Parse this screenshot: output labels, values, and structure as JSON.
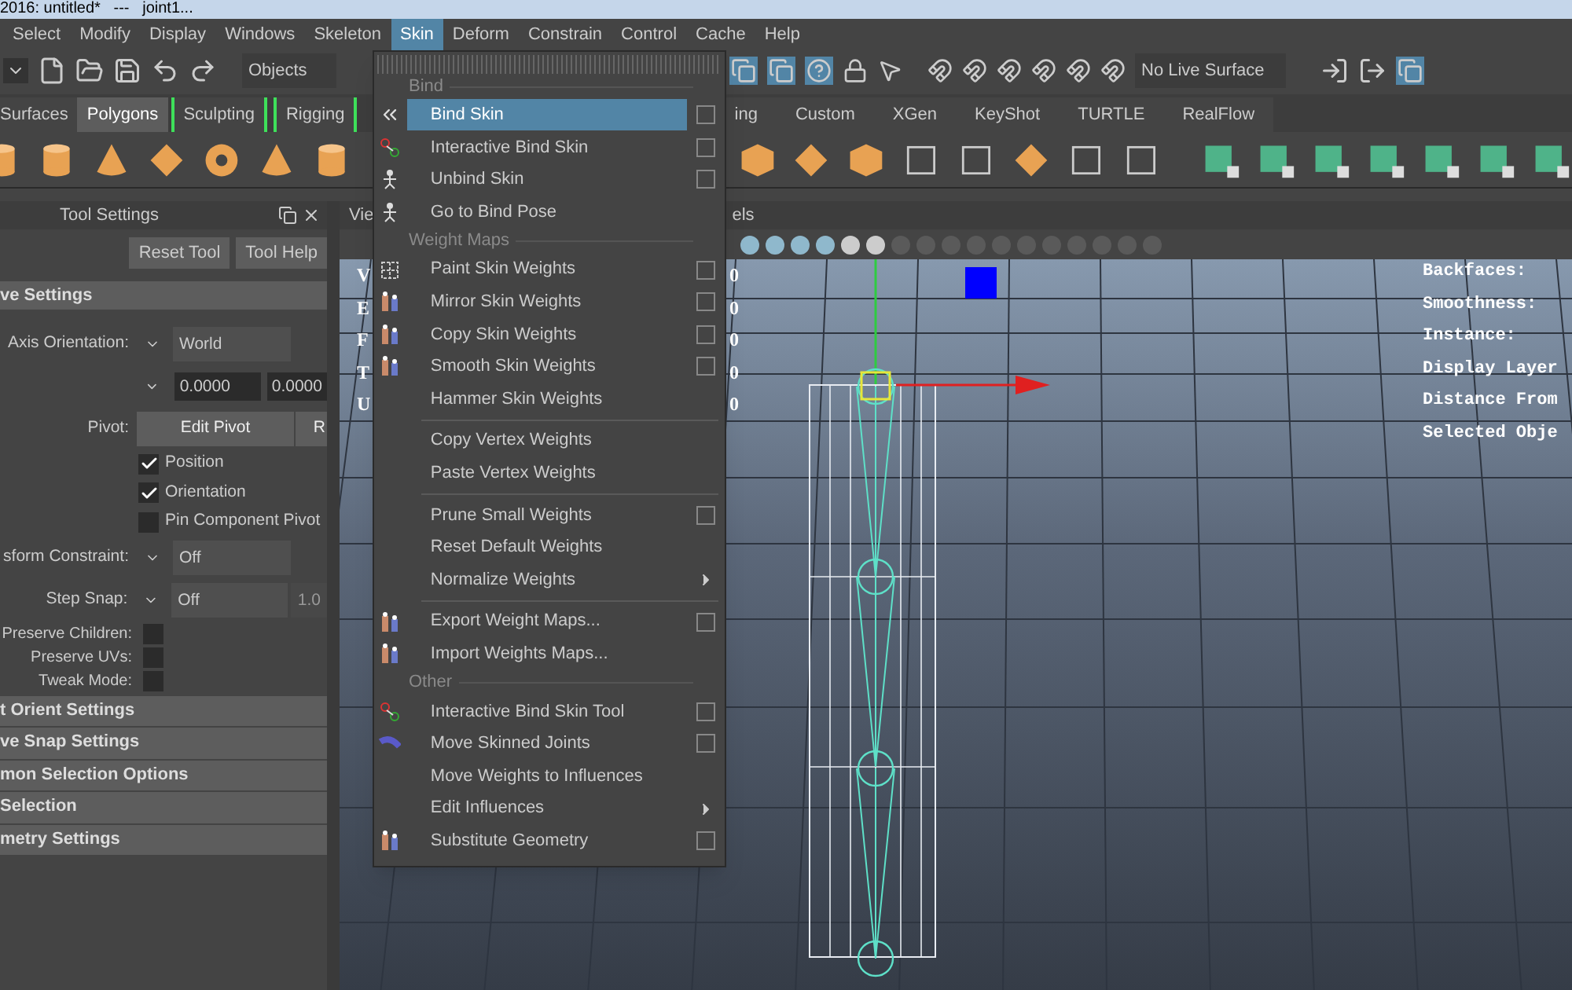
{
  "title_bar": {
    "title": "2016: untitled*   ---   joint1..."
  },
  "menu_bar": [
    {
      "label": "Select",
      "selected": false
    },
    {
      "label": "Modify",
      "selected": false
    },
    {
      "label": "Display",
      "selected": false
    },
    {
      "label": "Windows",
      "selected": false
    },
    {
      "label": "Skeleton",
      "selected": false
    },
    {
      "label": "Skin",
      "selected": true
    },
    {
      "label": "Deform",
      "selected": false
    },
    {
      "label": "Constrain",
      "selected": false
    },
    {
      "label": "Control",
      "selected": false
    },
    {
      "label": "Cache",
      "selected": false
    },
    {
      "label": "Help",
      "selected": false
    }
  ],
  "toolbar": {
    "selection_mode": "Objects",
    "live_surface": "No Live Surface"
  },
  "shelf_tabs": [
    {
      "label": "Surfaces",
      "selected": false,
      "bracketed": false
    },
    {
      "label": "Polygons",
      "selected": true,
      "bracketed": false
    },
    {
      "label": "Sculpting",
      "selected": false,
      "bracketed": true
    },
    {
      "label": "Rigging",
      "selected": false,
      "bracketed": true
    },
    {
      "label": "ing",
      "selected": false,
      "bracketed": false
    },
    {
      "label": "Custom",
      "selected": false,
      "bracketed": false
    },
    {
      "label": "XGen",
      "selected": false,
      "bracketed": false
    },
    {
      "label": "KeyShot",
      "selected": false,
      "bracketed": false
    },
    {
      "label": "TURTLE",
      "selected": false,
      "bracketed": false
    },
    {
      "label": "RealFlow",
      "selected": false,
      "bracketed": false
    }
  ],
  "tool_settings": {
    "title": "Tool Settings",
    "buttons": [
      "Reset Tool",
      "Tool Help"
    ],
    "section": "ve Settings",
    "rows": [
      {
        "kind": "dropdown",
        "label": "Axis Orientation:",
        "value": "World"
      },
      {
        "kind": "numbers",
        "values": [
          "0.0000",
          "0.0000"
        ]
      },
      {
        "kind": "buttons",
        "label": "Pivot:",
        "buttons": [
          "Edit Pivot",
          "R"
        ]
      },
      {
        "kind": "check",
        "label": "Position",
        "checked": true
      },
      {
        "kind": "check",
        "label": "Orientation",
        "checked": true
      },
      {
        "kind": "check",
        "label": "Pin Component Pivot",
        "checked": false
      },
      {
        "kind": "dropdown",
        "label": "sform Constraint:",
        "value": "Off"
      },
      {
        "kind": "dropdown",
        "label": "Step Snap:",
        "value": "Off",
        "extra": "1.0"
      },
      {
        "kind": "labeled_check",
        "label": "Preserve Children:",
        "checked": false
      },
      {
        "kind": "labeled_check",
        "label": "Preserve UVs:",
        "checked": false
      },
      {
        "kind": "labeled_check",
        "label": "Tweak Mode:",
        "checked": false
      }
    ],
    "collapsed_sections": [
      "t Orient Settings",
      "ve Snap Settings",
      "mon Selection Options",
      "Selection",
      "metry Settings"
    ]
  },
  "viewport": {
    "panel_tabs": [
      "Vie",
      "els"
    ],
    "hud_left": [
      {
        "label": "V",
        "value": "0"
      },
      {
        "label": "E",
        "value": "0"
      },
      {
        "label": "F",
        "value": "0"
      },
      {
        "label": "T",
        "value": "0"
      },
      {
        "label": "U",
        "value": "0"
      }
    ],
    "hud_right": [
      "Backfaces:",
      "Smoothness:",
      "Instance:",
      "Display Layer",
      "Distance From",
      "Selected Obje"
    ]
  },
  "skin_menu": {
    "items": [
      {
        "kind": "header",
        "label": "Bind"
      },
      {
        "kind": "option_item",
        "label": "Bind Skin",
        "selected": true
      },
      {
        "kind": "option_item",
        "label": "Interactive Bind Skin",
        "selected": false
      },
      {
        "kind": "option_item",
        "label": "Unbind Skin",
        "selected": false
      },
      {
        "kind": "item",
        "label": "Go to Bind Pose",
        "selected": false
      },
      {
        "kind": "header",
        "label": "Weight Maps"
      },
      {
        "kind": "option_item",
        "label": "Paint Skin Weights",
        "selected": false
      },
      {
        "kind": "option_item",
        "label": "Mirror Skin Weights",
        "selected": false
      },
      {
        "kind": "option_item",
        "label": "Copy Skin Weights",
        "selected": false
      },
      {
        "kind": "option_item",
        "label": "Smooth Skin Weights",
        "selected": false
      },
      {
        "kind": "item",
        "label": "Hammer Skin Weights",
        "selected": false
      },
      {
        "kind": "separator"
      },
      {
        "kind": "item",
        "label": "Copy Vertex Weights",
        "selected": false
      },
      {
        "kind": "item",
        "label": "Paste Vertex Weights",
        "selected": false
      },
      {
        "kind": "separator"
      },
      {
        "kind": "option_item",
        "label": "Prune Small Weights",
        "selected": false
      },
      {
        "kind": "item",
        "label": "Reset Default Weights",
        "selected": false
      },
      {
        "kind": "submenu_item",
        "label": "Normalize Weights",
        "selected": false
      },
      {
        "kind": "separator"
      },
      {
        "kind": "option_item",
        "label": "Export Weight Maps...",
        "selected": false
      },
      {
        "kind": "item",
        "label": "Import Weights Maps...",
        "selected": false
      },
      {
        "kind": "header",
        "label": "Other"
      },
      {
        "kind": "option_item",
        "label": "Interactive Bind Skin Tool",
        "selected": false
      },
      {
        "kind": "option_item",
        "label": "Move Skinned Joints",
        "selected": false
      },
      {
        "kind": "item",
        "label": "Move Weights to Influences",
        "selected": false
      },
      {
        "kind": "submenu_item",
        "label": "Edit Influences",
        "selected": false
      },
      {
        "kind": "option_item",
        "label": "Substitute Geometry",
        "selected": false
      }
    ]
  }
}
